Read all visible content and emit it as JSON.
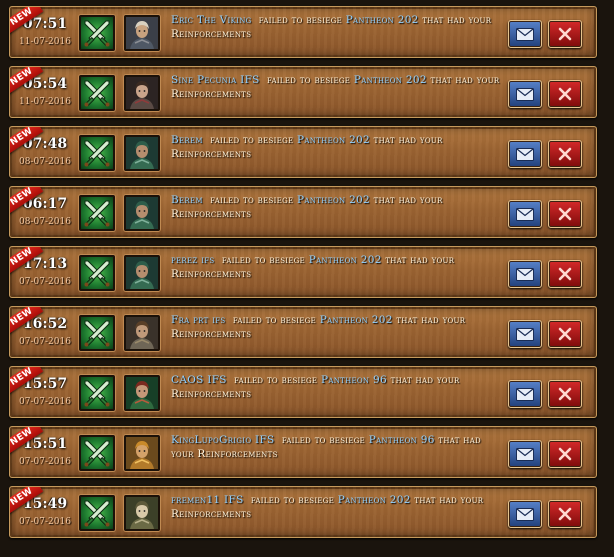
{
  "new_badge": "NEW",
  "message_template": {
    "action": "failed to besiege",
    "suffix": "that had your Reinforcements"
  },
  "icons": {
    "battle": "crossed-swords-icon",
    "mail": "envelope-icon",
    "delete": "close-x-icon"
  },
  "colors": {
    "player_name": "#8fd0ff",
    "message_text": "#fff4dd",
    "new_ribbon": "#d0190f",
    "mail_button": "#3a62a8",
    "delete_button": "#b01818"
  },
  "reports": [
    {
      "time": "07:51",
      "date": "11-07-2016",
      "player": "Eric The Viking",
      "target": "Pantheon 202",
      "avatar": "viking"
    },
    {
      "time": "05:54",
      "date": "11-07-2016",
      "player": "Sine Pecunia IFS",
      "target": "Pantheon 202",
      "avatar": "rogue"
    },
    {
      "time": "07:48",
      "date": "08-07-2016",
      "player": "Berem",
      "target": "Pantheon 202",
      "avatar": "soldier"
    },
    {
      "time": "06:17",
      "date": "08-07-2016",
      "player": "Berem",
      "target": "Pantheon 202",
      "avatar": "soldier"
    },
    {
      "time": "17:13",
      "date": "07-07-2016",
      "player": "perez ifs",
      "target": "Pantheon 202",
      "avatar": "soldier"
    },
    {
      "time": "16:52",
      "date": "07-07-2016",
      "player": "Fra prt ifs",
      "target": "Pantheon 202",
      "avatar": "warrior"
    },
    {
      "time": "15:57",
      "date": "07-07-2016",
      "player": "CAOS IFS",
      "target": "Pantheon 96",
      "avatar": "ranger"
    },
    {
      "time": "15:51",
      "date": "07-07-2016",
      "player": "KingLupoGrigio IFS",
      "target": "Pantheon 96",
      "avatar": "gold-knight"
    },
    {
      "time": "15:49",
      "date": "07-07-2016",
      "player": "fremen11 IFS",
      "target": "Pantheon 202",
      "avatar": "pale-fighter"
    }
  ]
}
